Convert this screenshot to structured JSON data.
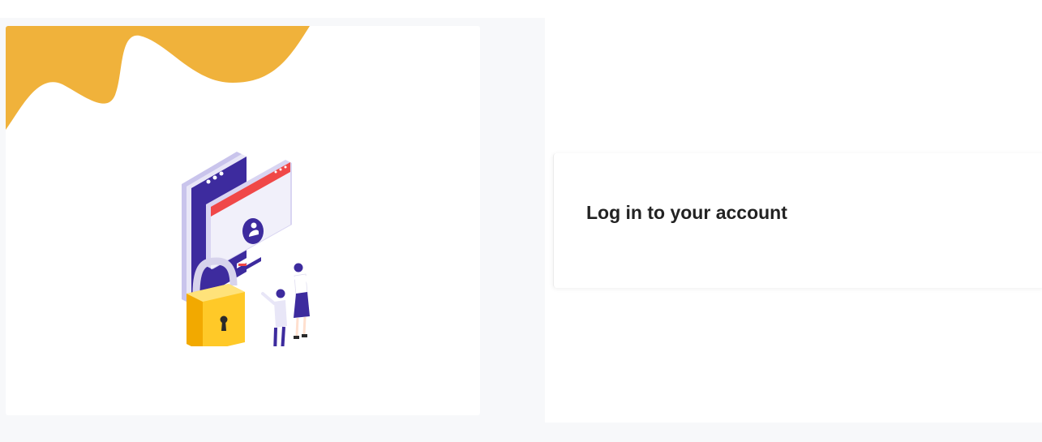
{
  "illustration": {
    "wave_color": "#f0b23b",
    "phone_color": "#3d2b9e",
    "lock_color": "#ffc928",
    "accent_red": "#f04848",
    "subject": "security-login-illustration"
  },
  "login": {
    "title": "Log in to your account"
  }
}
